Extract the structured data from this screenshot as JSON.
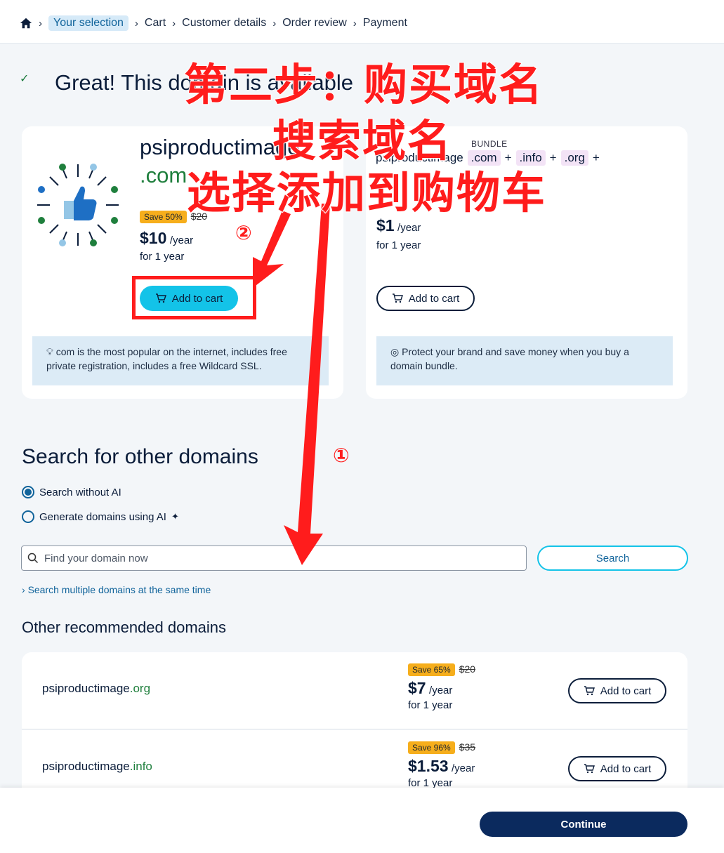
{
  "breadcrumb": {
    "items": [
      "Your selection",
      "Cart",
      "Customer details",
      "Order review",
      "Payment"
    ]
  },
  "status": {
    "heading": "Great! This domain is available"
  },
  "featured": {
    "domain_name": "psiproductimage",
    "tld": ".com",
    "save_badge": "Save 50%",
    "old_price": "$20",
    "price": "$10",
    "per": "/year",
    "term": "for 1 year",
    "button": "Add to cart",
    "info": "com is the most popular on the internet, includes free private registration, includes a free Wildcard SSL."
  },
  "bundle": {
    "tag": "BUNDLE",
    "name": "psiproductimage",
    "tlds": [
      ".com",
      ".info",
      ".org"
    ],
    "price": "$1",
    "per": "/year",
    "term": "for 1 year",
    "button": "Add to cart",
    "info": "Protect your brand and save money when you buy a domain bundle."
  },
  "search": {
    "heading": "Search for other domains",
    "option_without_ai": "Search without AI",
    "option_with_ai": "Generate domains using AI",
    "placeholder": "Find your domain now",
    "button": "Search",
    "multi_link": "Search multiple domains at the same time"
  },
  "recommended": {
    "heading": "Other recommended domains",
    "items": [
      {
        "name": "psiproductimage",
        "tld": ".org",
        "save_badge": "Save 65%",
        "old_price": "$20",
        "price": "$7",
        "per": "/year",
        "term": "for 1 year",
        "button": "Add to cart"
      },
      {
        "name": "psiproductimage",
        "tld": ".info",
        "save_badge": "Save 96%",
        "old_price": "$35",
        "price": "$1.53",
        "per": "/year",
        "term": "for 1 year",
        "button": "Add to cart"
      }
    ]
  },
  "footer": {
    "continue": "Continue"
  },
  "annotation": {
    "line1": "第二步：购买域名",
    "line2": "搜索域名",
    "line3": "选择添加到购物车",
    "marker1": "①",
    "marker2": "②",
    "color": "#ff1c1c"
  },
  "colors": {
    "accent": "#13c3e8",
    "primary": "#0b2a5e",
    "tld_green": "#1f7f3d",
    "save_badge": "#f6ae1c"
  }
}
